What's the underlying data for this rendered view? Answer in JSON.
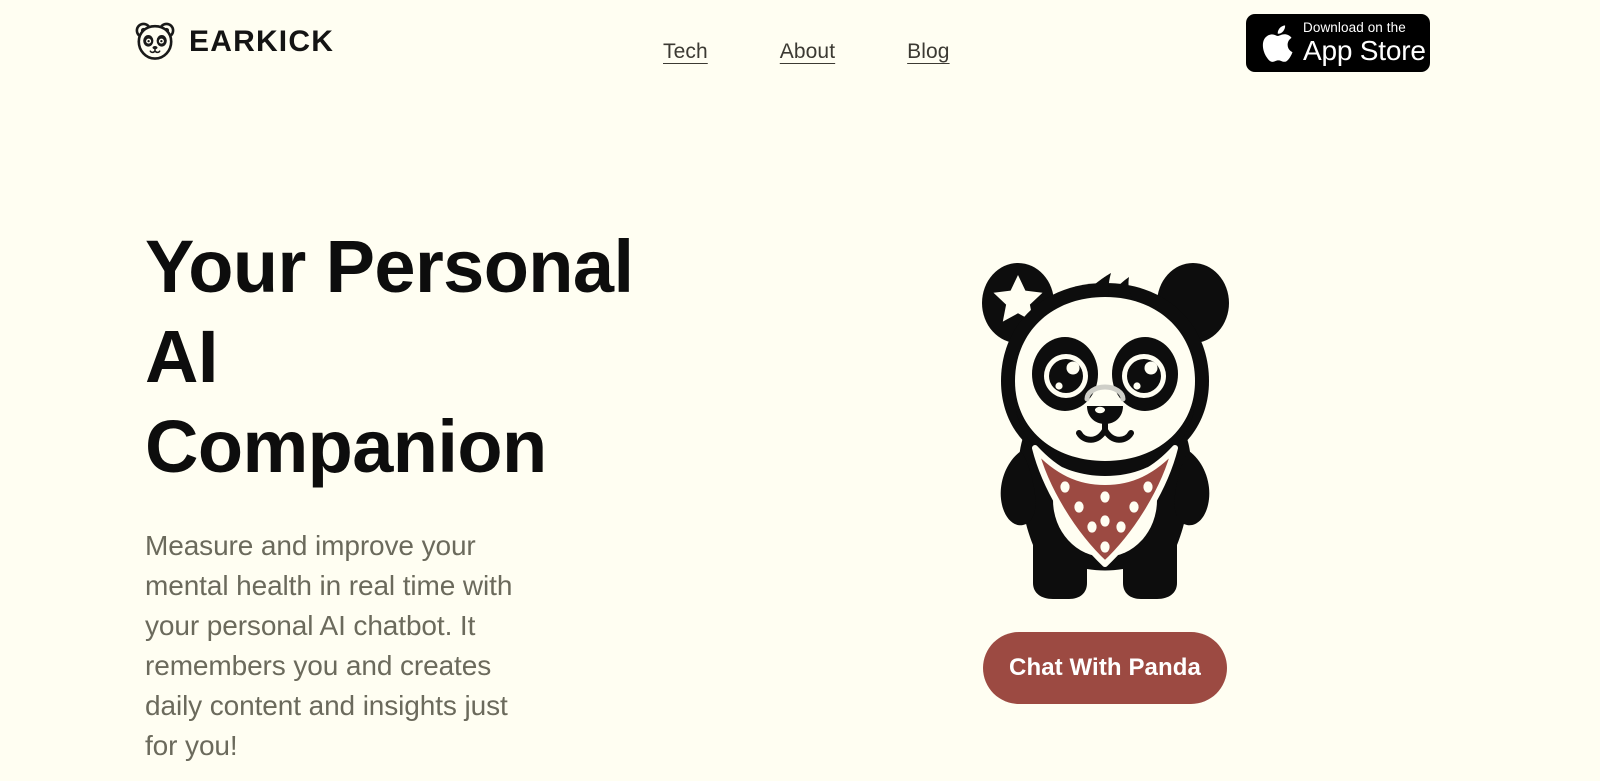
{
  "page": {
    "background_color": "#FFFEF2",
    "heading_color": "#0D0D0D",
    "body_text_color": "#6B6A5C",
    "accent_color": "#9C4A42"
  },
  "header": {
    "brand": {
      "name": "EARKICK",
      "logo_icon": "panda-head-icon"
    },
    "nav": [
      {
        "label": "Tech"
      },
      {
        "label": "About"
      },
      {
        "label": "Blog"
      }
    ],
    "appstore": {
      "icon": "apple-logo-icon",
      "line1": "Download on the",
      "line2": "App Store"
    }
  },
  "hero": {
    "title_line1": "Your Personal AI",
    "title_line2": "Companion",
    "subtitle": "Measure and improve your mental health in real time with your personal AI chatbot. It remembers you and creates daily content and insights just for you!",
    "mascot": {
      "icon": "panda-mascot-illustration",
      "bandana_color": "#9C4A42",
      "star_icon": "star-icon"
    },
    "cta": {
      "label": "Chat With Panda"
    }
  }
}
